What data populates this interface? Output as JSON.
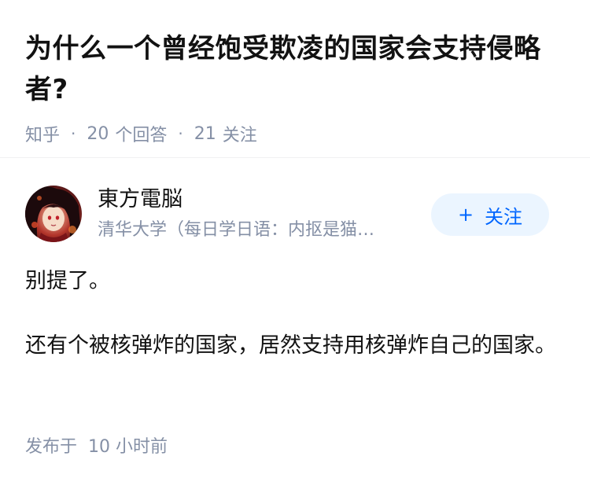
{
  "question": {
    "title": "为什么一个曾经饱受欺凌的国家会支持侵略者?",
    "source": "知乎",
    "separator": "·",
    "answer_count": "20",
    "answer_label": "个回答",
    "follower_count": "21",
    "follower_label": "关注"
  },
  "author": {
    "name": "東方電脳",
    "bio": "清华大学（每日学日语：内抠是猫…",
    "follow_button": {
      "icon": "+",
      "label": "关注"
    }
  },
  "answer": {
    "paragraphs": [
      "别提了。",
      "还有个被核弹炸的国家，居然支持用核弹炸自己的国家。"
    ],
    "time_label": "发布于",
    "time_value": "10 小时前"
  },
  "colors": {
    "accent": "#0066ff",
    "follow_bg": "#ebf5ff",
    "meta_text": "#8590a6",
    "title_text": "#121212"
  }
}
